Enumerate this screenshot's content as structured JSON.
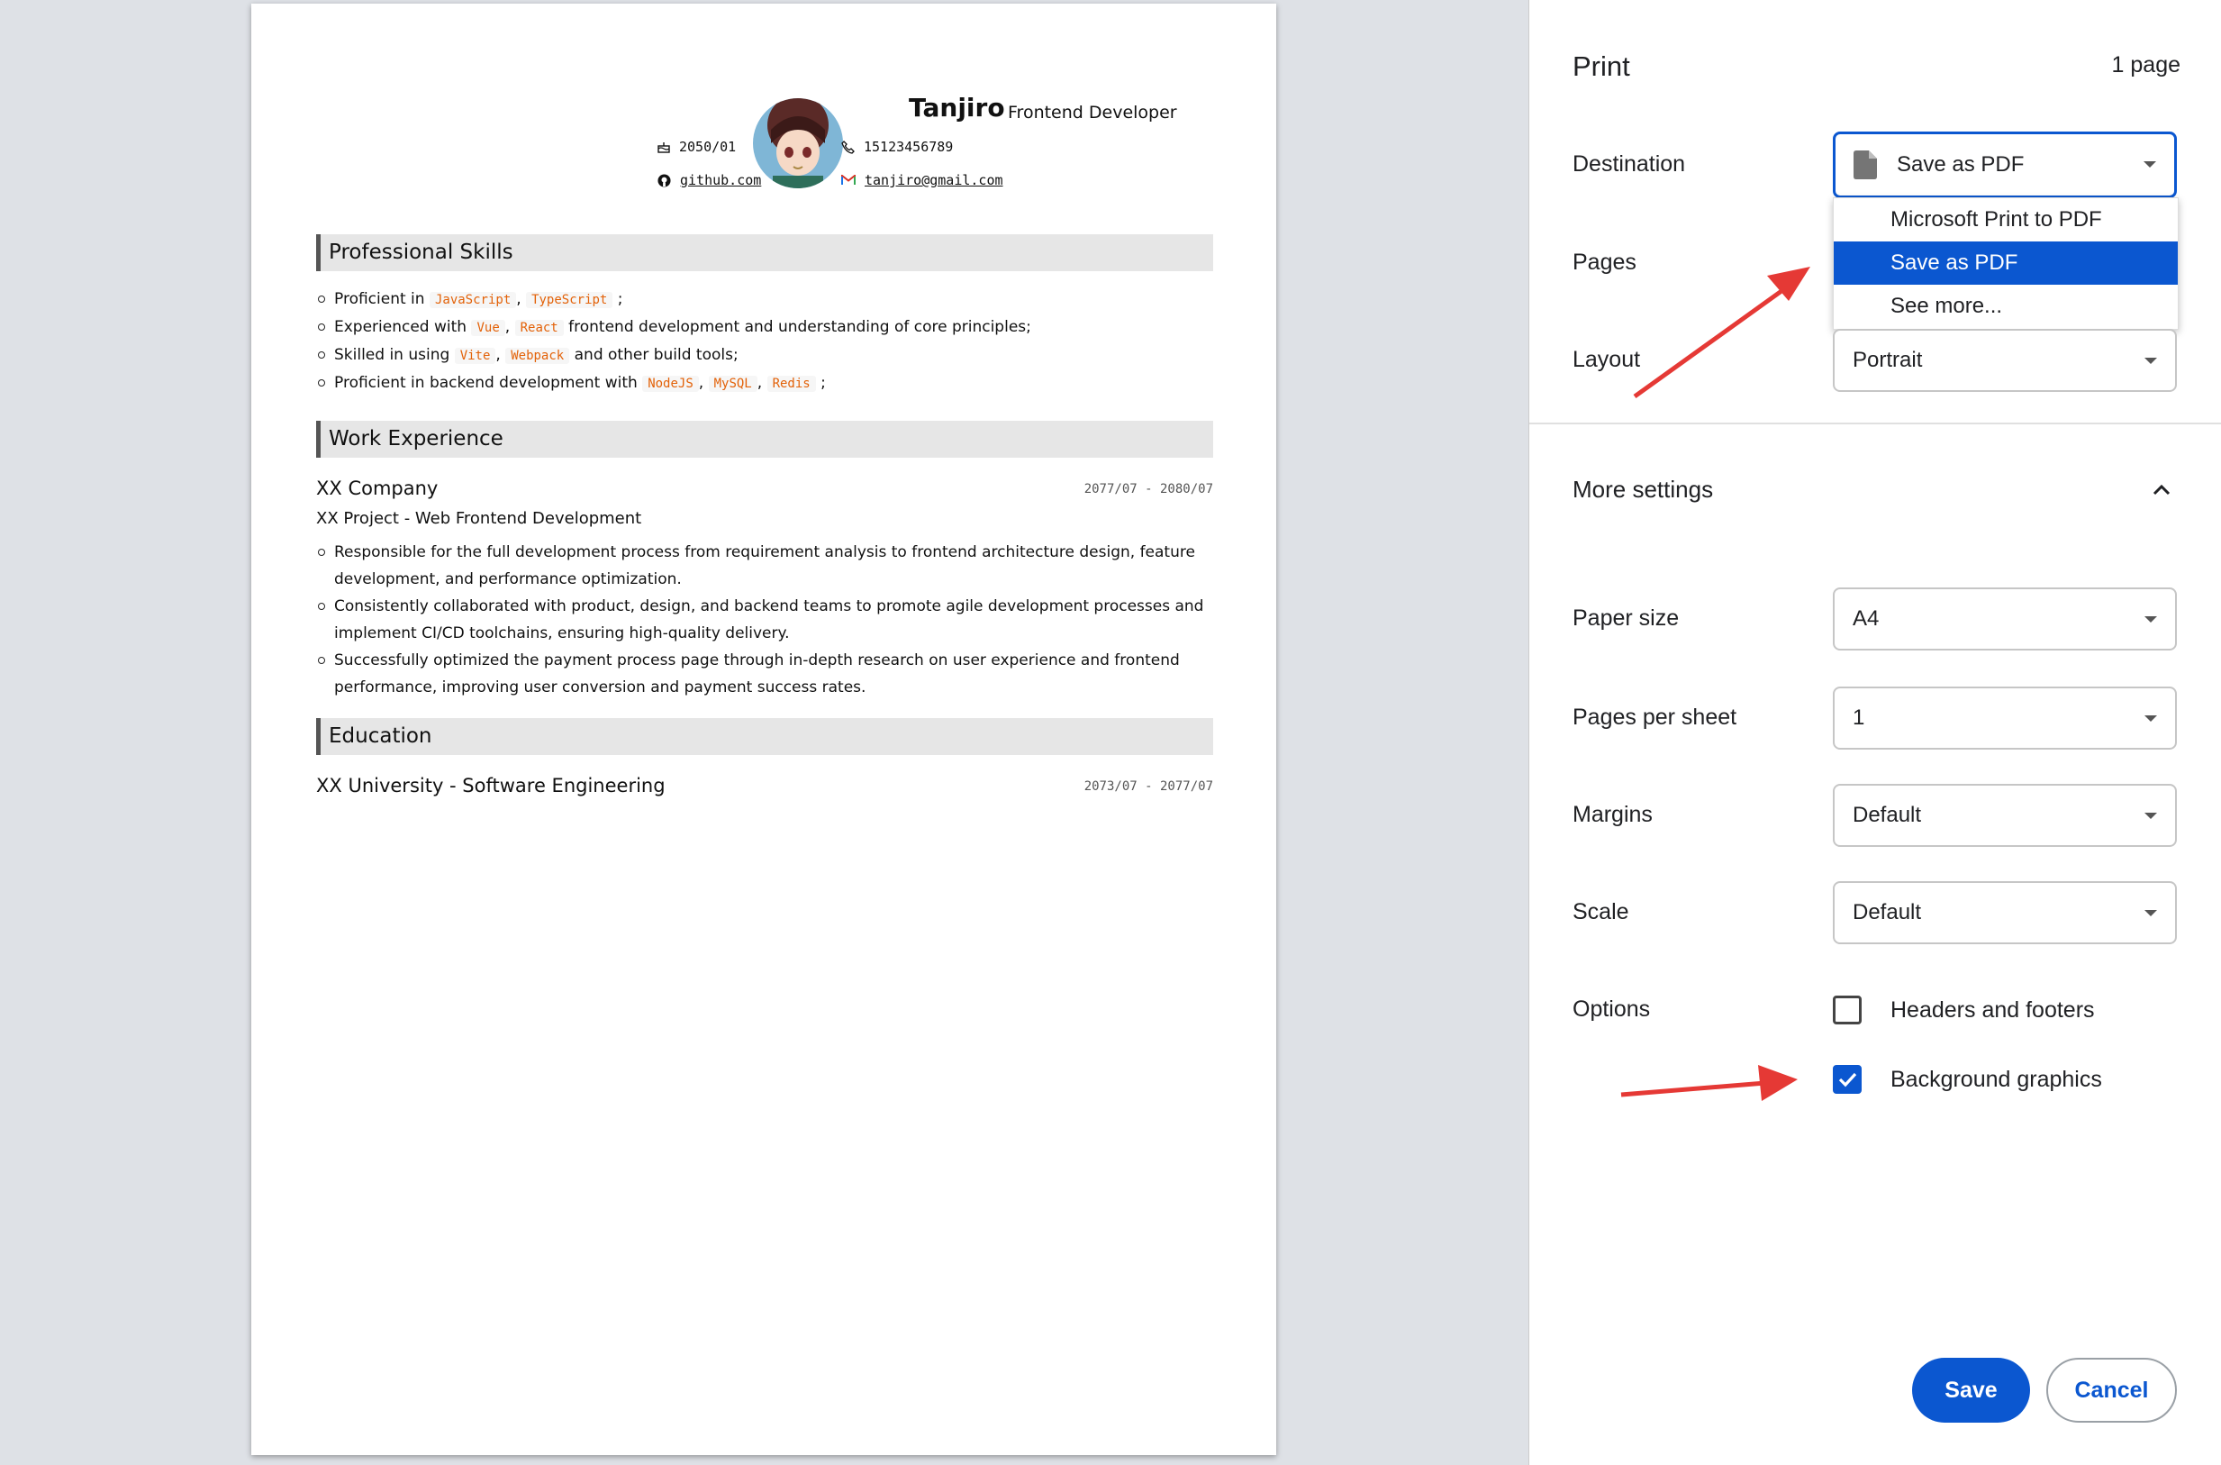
{
  "resume": {
    "name": "Tanjiro",
    "role": "Frontend Developer",
    "birth": "2050/01",
    "phone": "15123456789",
    "github": "github.com",
    "email": "tanjiro@gmail.com",
    "sections": {
      "skills": "Professional Skills",
      "work": "Work Experience",
      "education": "Education"
    },
    "skills": [
      {
        "pre": "Proficient in",
        "tags": [
          "JavaScript",
          "TypeScript"
        ],
        "post": ";"
      },
      {
        "pre": "Experienced with",
        "tags": [
          "Vue",
          "React"
        ],
        "post": "frontend development and understanding of core principles;"
      },
      {
        "pre": "Skilled in using",
        "tags": [
          "Vite",
          "Webpack"
        ],
        "post": "and other build tools;"
      },
      {
        "pre": "Proficient in backend development with",
        "tags": [
          "NodeJS",
          "MySQL",
          "Redis"
        ],
        "post": ";"
      }
    ],
    "work": {
      "company": "XX Company",
      "dates": "2077/07 - 2080/07",
      "project": "XX Project - Web Frontend Development",
      "bullets": [
        "Responsible for the full development process from requirement analysis to frontend architecture design, feature development, and performance optimization.",
        "Consistently collaborated with product, design, and backend teams to promote agile development processes and implement CI/CD toolchains, ensuring high-quality delivery.",
        "Successfully optimized the payment process page through in-depth research on user experience and frontend performance, improving user conversion and payment success rates."
      ]
    },
    "education": {
      "school": "XX University - Software Engineering",
      "dates": "2073/07 - 2077/07"
    }
  },
  "print": {
    "title": "Print",
    "page_count": "1 page",
    "labels": {
      "destination": "Destination",
      "pages": "Pages",
      "layout": "Layout",
      "more_settings": "More settings",
      "paper_size": "Paper size",
      "pages_per_sheet": "Pages per sheet",
      "margins": "Margins",
      "scale": "Scale",
      "options": "Options"
    },
    "destination_value": "Save as PDF",
    "destination_options": [
      "Microsoft Print to PDF",
      "Save as PDF",
      "See more..."
    ],
    "layout_value": "Portrait",
    "paper_size_value": "A4",
    "pages_per_sheet_value": "1",
    "margins_value": "Default",
    "scale_value": "Default",
    "options": {
      "headers_footers": {
        "label": "Headers and footers",
        "checked": false
      },
      "background_graphics": {
        "label": "Background graphics",
        "checked": true
      }
    },
    "buttons": {
      "save": "Save",
      "cancel": "Cancel"
    }
  },
  "colors": {
    "accent": "#0b57d0",
    "annotation_arrow": "#e53935",
    "code_tag": "#e36209"
  }
}
